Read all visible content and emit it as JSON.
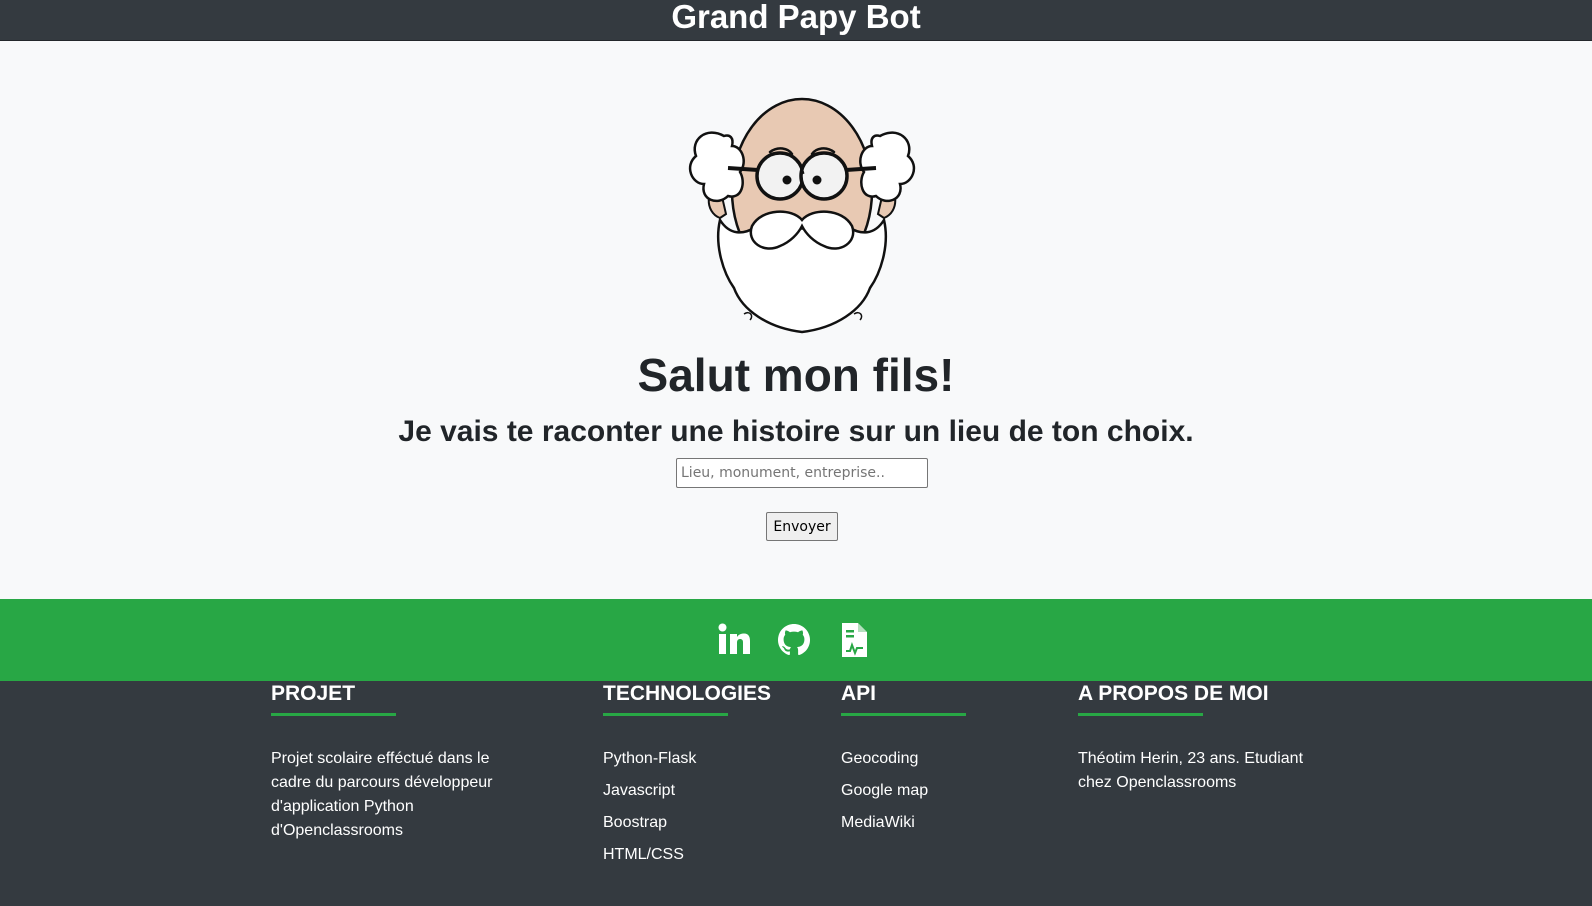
{
  "header": {
    "brand": "Grand Papy Bot"
  },
  "main": {
    "greeting": "Salut mon fils!",
    "subtitle": "Je vais te raconter une histoire sur un lieu de ton choix.",
    "search": {
      "placeholder": "Lieu, monument, entreprise..",
      "value": ""
    },
    "send_label": "Envoyer"
  },
  "social": {
    "icons": [
      "linkedin-icon",
      "github-icon",
      "document-icon"
    ]
  },
  "footer": {
    "projet": {
      "title": "Projet",
      "text": "Projet scolaire efféctué dans le cadre du parcours développeur d'application Python d'Openclassrooms"
    },
    "technologies": {
      "title": "Technologies",
      "items": [
        "Python-Flask",
        "Javascript",
        "Boostrap",
        "HTML/CSS"
      ]
    },
    "api": {
      "title": "API",
      "items": [
        "Geocoding",
        "Google map",
        "MediaWiki"
      ]
    },
    "about": {
      "title": "A propos de moi",
      "text": "Théotim Herin, 23 ans. Etudiant chez Openclassrooms"
    }
  },
  "colors": {
    "navbar": "#343a40",
    "accent_green": "#28a745",
    "page_bg": "#f8f9fa",
    "footer_bg": "#343a40"
  }
}
